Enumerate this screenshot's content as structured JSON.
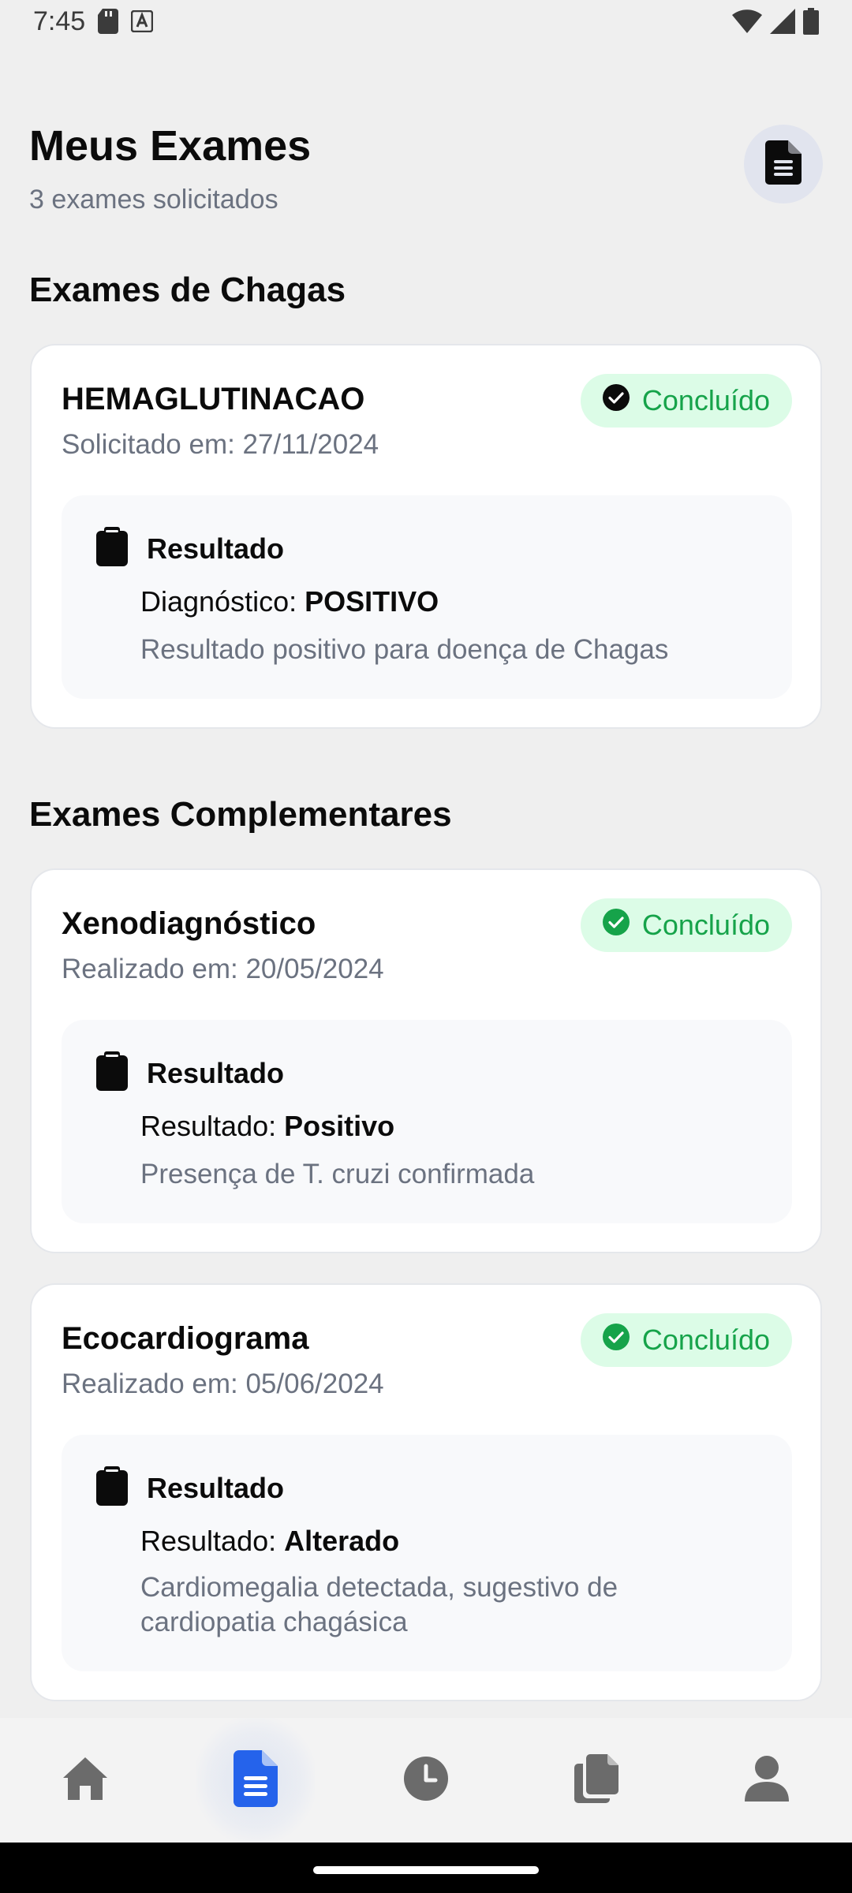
{
  "status_bar": {
    "time": "7:45"
  },
  "header": {
    "title": "Meus Exames",
    "subtitle": "3 exames solicitados",
    "action_icon": "document-icon"
  },
  "sections": {
    "chagas": {
      "title": "Exames de Chagas"
    },
    "complementares": {
      "title": "Exames Complementares"
    }
  },
  "cards": [
    {
      "name": "HEMAGLUTINACAO",
      "date": "Solicitado em: 27/11/2024",
      "status": "Concluído",
      "result_label": "Resultado",
      "line_prefix": "Diagnóstico: ",
      "line_value": "POSITIVO",
      "description": "Resultado positivo para doença de Chagas"
    },
    {
      "name": "Xenodiagnóstico",
      "date": "Realizado em: 20/05/2024",
      "status": "Concluído",
      "result_label": "Resultado",
      "line_prefix": "Resultado: ",
      "line_value": "Positivo",
      "description": "Presença de T. cruzi confirmada"
    },
    {
      "name": "Ecocardiograma",
      "date": "Realizado em: 05/06/2024",
      "status": "Concluído",
      "result_label": "Resultado",
      "line_prefix": "Resultado: ",
      "line_value": "Alterado",
      "description": "Cardiomegalia detectada, sugestivo de cardiopatia chagásica"
    }
  ],
  "bottom_nav": {
    "items": [
      {
        "icon": "home-icon",
        "active": false
      },
      {
        "icon": "document-icon",
        "active": true
      },
      {
        "icon": "clock-icon",
        "active": false
      },
      {
        "icon": "files-icon",
        "active": false
      },
      {
        "icon": "profile-icon",
        "active": false
      }
    ]
  },
  "colors": {
    "accent": "#2563eb",
    "success": "#16a34a",
    "success_bg": "#dcfce7",
    "muted_text": "#6b7280"
  }
}
